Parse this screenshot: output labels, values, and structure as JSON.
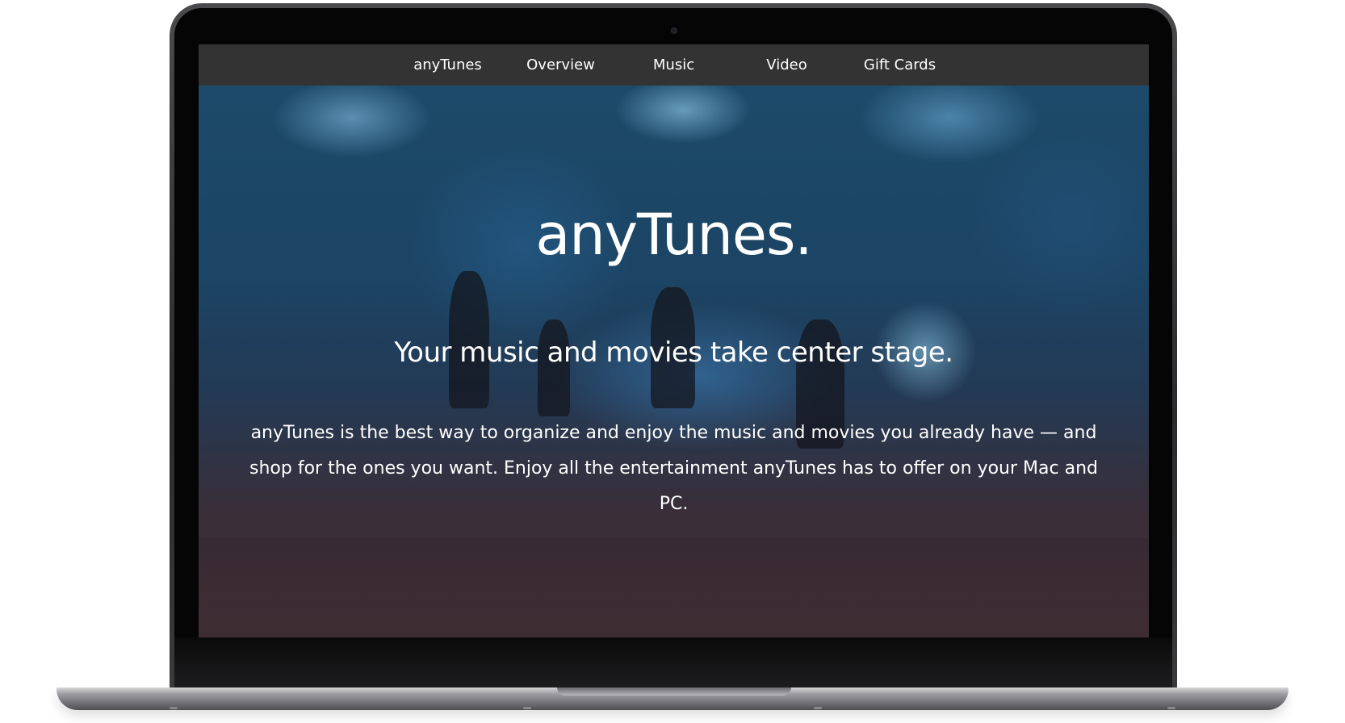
{
  "nav": {
    "items": [
      {
        "label": "anyTunes"
      },
      {
        "label": "Overview"
      },
      {
        "label": "Music"
      },
      {
        "label": "Video"
      },
      {
        "label": "Gift Cards"
      }
    ]
  },
  "hero": {
    "title": "anyTunes.",
    "subtitle": "Your music and movies take center stage.",
    "description": "anyTunes is the best way to organize and enjoy the music and movies you already have — and shop for the ones you want. Enjoy all the entertainment anyTunes has to offer on your Mac and PC."
  },
  "colors": {
    "navbar": "#333333",
    "text": "#ffffff",
    "hero_bottom": "#3d2d33",
    "hero_top": "#1d4a6a"
  }
}
